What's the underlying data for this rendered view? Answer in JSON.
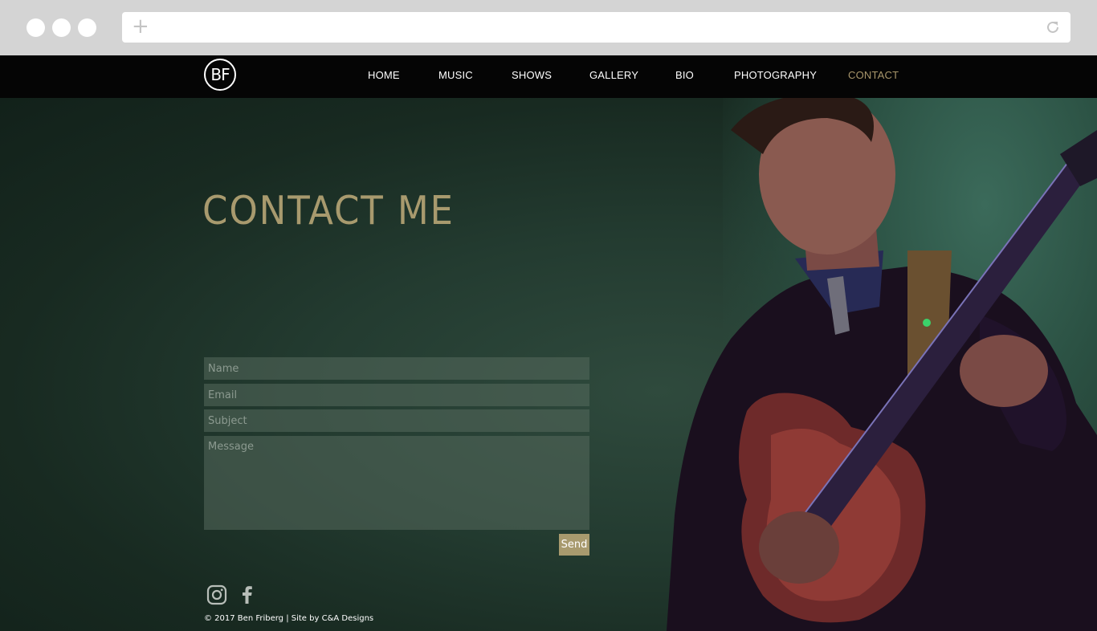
{
  "browser": {
    "new_tab_icon": "plus-icon",
    "reload_icon": "reload-icon"
  },
  "nav": {
    "logo_text": "BF",
    "items": [
      {
        "label": "HOME"
      },
      {
        "label": "MUSIC"
      },
      {
        "label": "SHOWS"
      },
      {
        "label": "GALLERY"
      },
      {
        "label": "BIO"
      },
      {
        "label": "PHOTOGRAPHY"
      },
      {
        "label": "CONTACT",
        "active": true
      }
    ]
  },
  "page": {
    "title": "CONTACT ME"
  },
  "form": {
    "name_placeholder": "Name",
    "email_placeholder": "Email",
    "subject_placeholder": "Subject",
    "message_placeholder": "Message",
    "send_label": "Send"
  },
  "footer": {
    "social_icons": [
      "instagram-icon",
      "facebook-icon"
    ],
    "copyright": "© 2017 Ben Friberg | Site by C&A Designs"
  },
  "colors": {
    "accent": "#a89a6e",
    "nav_bg": "#050505",
    "hero_bg": "#1c3128",
    "chrome_bg": "#d4d4d4"
  }
}
